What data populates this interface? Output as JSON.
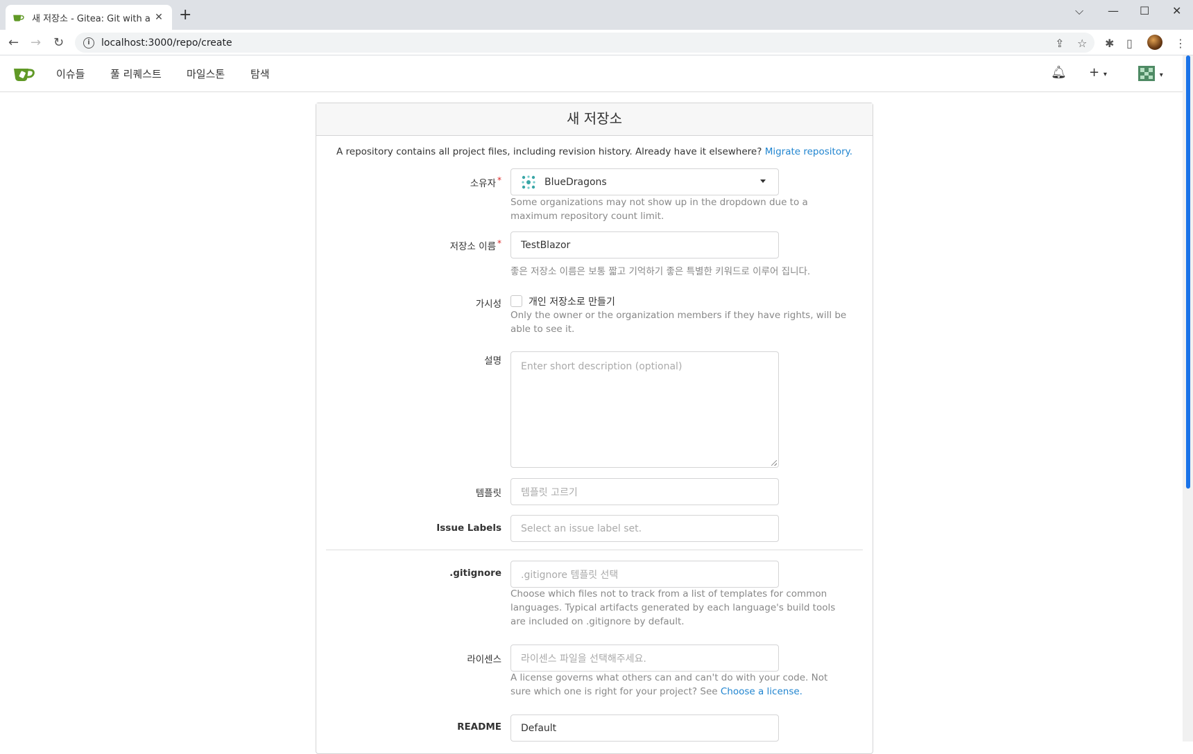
{
  "browser": {
    "tab_title": "새 저장소 - Gitea: Git with a cup",
    "url": "localhost:3000/repo/create"
  },
  "nav": {
    "items": [
      "이슈들",
      "풀 리퀘스트",
      "마일스톤",
      "탐색"
    ]
  },
  "form": {
    "header": "새 저장소",
    "intro_text": "A repository contains all project files, including revision history. Already have it elsewhere?",
    "intro_link": "Migrate repository.",
    "owner": {
      "label": "소유자",
      "value": "BlueDragons",
      "help": "Some organizations may not show up in the dropdown due to a maximum repository count limit."
    },
    "repo_name": {
      "label": "저장소 이름",
      "value": "TestBlazor",
      "help": "좋은 저장소 이름은 보통 짧고 기억하기 좋은 특별한 키워드로 이루어 집니다."
    },
    "visibility": {
      "label": "가시성",
      "checkbox_label": "개인 저장소로 만들기",
      "checked": false,
      "help": "Only the owner or the organization members if they have rights, will be able to see it."
    },
    "description": {
      "label": "설명",
      "placeholder": "Enter short description (optional)"
    },
    "template": {
      "label": "템플릿",
      "placeholder": "템플릿 고르기"
    },
    "issue_labels": {
      "label": "Issue Labels",
      "placeholder": "Select an issue label set."
    },
    "gitignore": {
      "label": ".gitignore",
      "placeholder": ".gitignore 템플릿 선택",
      "help": "Choose which files not to track from a list of templates for common languages. Typical artifacts generated by each language's build tools are included on .gitignore by default."
    },
    "license": {
      "label": "라이센스",
      "placeholder": "라이센스 파일을 선택해주세요.",
      "help_text": "A license governs what others can and can't do with your code. Not sure which one is right for your project? See",
      "help_link": "Choose a license."
    },
    "readme": {
      "label": "README",
      "value": "Default"
    }
  },
  "colors": {
    "accent": "#2185d0",
    "gitea_green": "#609926",
    "required": "#db2828"
  }
}
